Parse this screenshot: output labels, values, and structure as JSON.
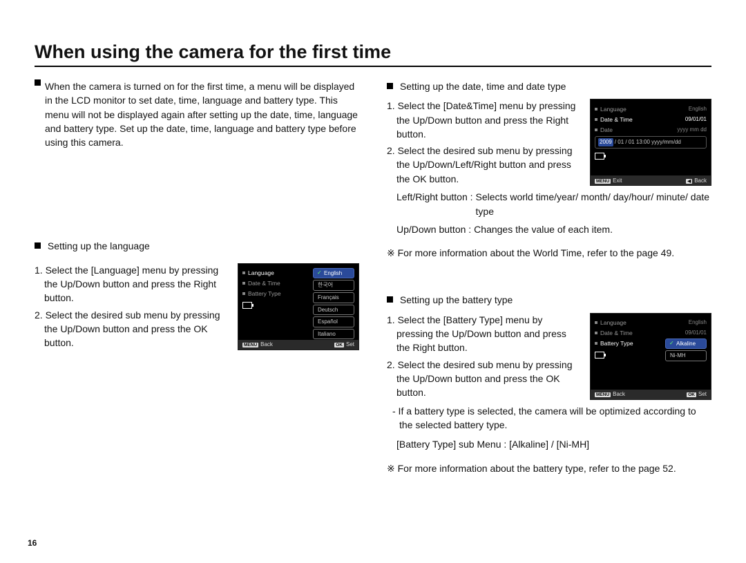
{
  "title": "When using the camera for the first time",
  "page_number": "16",
  "intro": "When the camera is turned on for the first time, a menu will be displayed in the LCD monitor to set date, time, language and battery type. This menu will not be displayed again after setting up the date, time, language and battery type. Set up the date, time, language and battery type before using this camera.",
  "language": {
    "heading": "Setting up the language",
    "step1": "1. Select the [Language] menu by pressing the Up/Down button and press the Right button.",
    "step2": "2. Select the desired sub menu by pressing the Up/Down button and press the OK button.",
    "lcd": {
      "menu": [
        {
          "label": "Language",
          "active": true
        },
        {
          "label": "Date & Time",
          "active": false
        },
        {
          "label": "Battery Type",
          "active": false
        }
      ],
      "options": [
        "English",
        "한국어",
        "Français",
        "Deutsch",
        "Español",
        "Italiano"
      ],
      "selected": "English",
      "footerLeftKey": "MENU",
      "footerLeft": "Back",
      "footerRightKey": "OK",
      "footerRight": "Set"
    }
  },
  "datetime": {
    "heading": "Setting up the date, time and date type",
    "step1": "1. Select the [Date&Time] menu by pressing the Up/Down button and press the Right button.",
    "step2": "2. Select the desired sub menu by pressing the Up/Down/Left/Right button and press the OK button.",
    "lr_label": "Left/Right button :",
    "lr_desc": "Selects world time/year/ month/ day/hour/ minute/ date type",
    "ud_label": "Up/Down button :",
    "ud_desc": "Changes the value of each item.",
    "ref": "※ For more information about the World Time, refer to the page 49.",
    "lcd": {
      "menu": [
        {
          "label": "Language",
          "value": "English",
          "active": false
        },
        {
          "label": "Date & Time",
          "value": "09/01/01",
          "active": true
        },
        {
          "label": "Date",
          "value": "yyyy mm dd",
          "active": false
        }
      ],
      "editRow": {
        "year": "2009",
        "rest": "/ 01 / 01   13:00   yyyy/mm/dd"
      },
      "footerLeftKey": "MENU",
      "footerLeft": "Exit",
      "footerRightKey": "◀",
      "footerRight": "Back"
    }
  },
  "battery": {
    "heading": "Setting up the battery type",
    "step1": "1. Select the [Battery Type] menu by pressing the Up/Down button and press the Right button.",
    "step2": "2. Select the desired sub menu by pressing the Up/Down button and press the OK button.",
    "note": "- If a battery type is selected, the camera will be optimized according to the selected battery type.",
    "submenu_note": "[Battery Type] sub Menu : [Alkaline] / [Ni-MH]",
    "ref": "※ For more information about the battery type, refer to the page 52.",
    "lcd": {
      "menu": [
        {
          "label": "Language",
          "value": "English",
          "active": false
        },
        {
          "label": "Date & Time",
          "value": "09/01/01",
          "active": false
        },
        {
          "label": "Battery Type",
          "value": "",
          "active": true
        }
      ],
      "options": [
        "Alkaline",
        "Ni-MH"
      ],
      "selected": "Alkaline",
      "footerLeftKey": "MENU",
      "footerLeft": "Back",
      "footerRightKey": "OK",
      "footerRight": "Set"
    }
  }
}
